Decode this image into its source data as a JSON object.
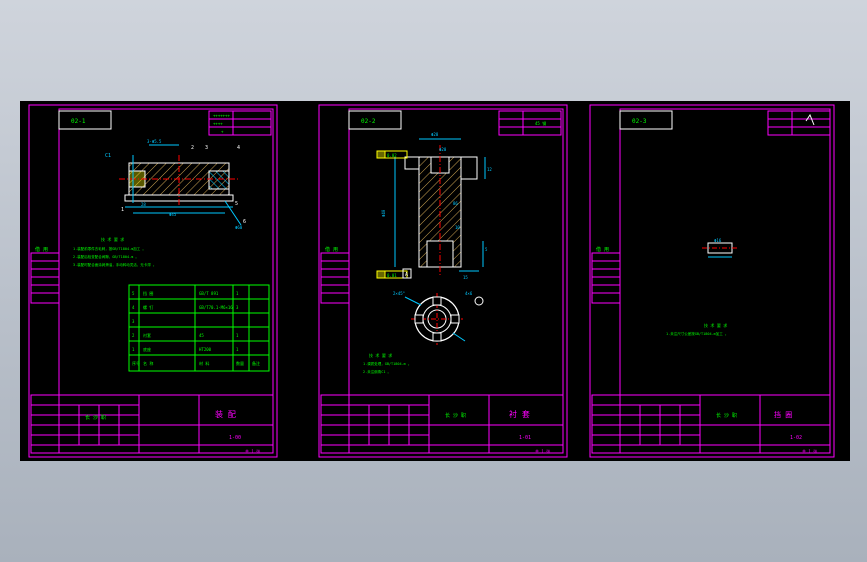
{
  "colors": {
    "background": "#000000",
    "frame": "#ff00ff",
    "line": "#ffffff",
    "dimension": "#00c8ff",
    "text": "#00ff00",
    "table": "#00ff00",
    "hatch": "#c8a050",
    "highlight": "#ffff00"
  },
  "sheets": [
    {
      "code_box": "02-1",
      "company": "长 沙 职",
      "drawing_title": "装 配",
      "drawing_no": "1-00",
      "footer": "共 1 张",
      "left_label": "借 用",
      "tech_notes": [
        "技 术 要 求",
        "1.装配前零件去毛刺，按GB/T1804-m加工 。",
        "2.装配后检查配合间隙，GB/T1804-m 。",
        "3.装配时配合面涂润滑油，手动转动灵活，无卡滞 。"
      ],
      "callouts": [
        "1",
        "2",
        "3",
        "4",
        "5",
        "6"
      ],
      "dim_top": "3-Φ5.5",
      "dim_left": "C1",
      "dim_bottom": [
        "28",
        "Φ45",
        "Φ60"
      ],
      "bom_rows": [
        [
          "5",
          "挡 圈",
          "GB/T 891",
          "1",
          ""
        ],
        [
          "4",
          "螺 钉",
          "GB/T70.1-M6×16",
          "3",
          ""
        ],
        [
          "3",
          "",
          "",
          "",
          ""
        ],
        [
          "2",
          "衬套",
          "45",
          "1",
          ""
        ],
        [
          "1",
          "底座",
          "HT200",
          "1",
          ""
        ],
        [
          "序号",
          "名 称",
          "材 料",
          "数量",
          "备注"
        ]
      ]
    },
    {
      "code_box": "02-2",
      "company": "长 沙 职",
      "drawing_title": "衬 套",
      "drawing_no": "1-01",
      "material": "45 钢",
      "footer": "共 1 张",
      "left_label": "借 用",
      "dims": [
        "Φ28",
        "Φ20",
        "12",
        "Φ40",
        "86",
        "10",
        "5",
        "15",
        "2×45°",
        "4×6"
      ],
      "tolerance_labels": [
        "0.02",
        "0.01"
      ],
      "datum": "A",
      "tech_notes": [
        "技 术 要 求",
        "1.调质处理，GB/T1804-m 。",
        "2.未注倒角C1 。"
      ]
    },
    {
      "code_box": "02-3",
      "company": "长 沙 职",
      "drawing_title": "挡 圈",
      "drawing_no": "1-02",
      "footer": "共 1 张",
      "left_label": "借 用",
      "dim": "Φ16",
      "tech_notes": [
        "技 术 要 求",
        "1.未注尺寸公差按GB/T1804-m加工 。"
      ]
    }
  ]
}
